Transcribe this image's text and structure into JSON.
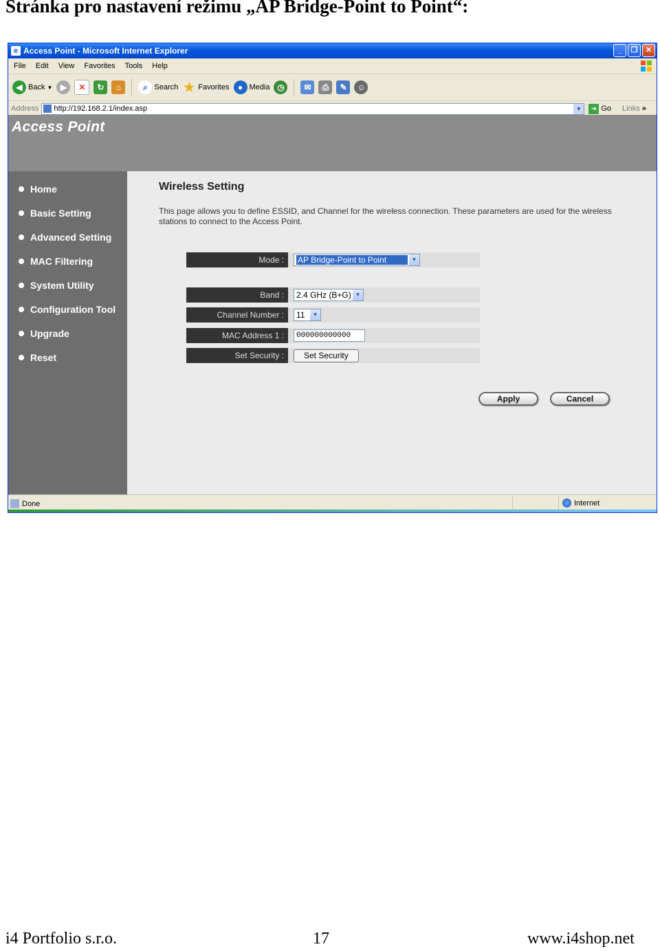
{
  "document": {
    "title": "Stránka pro nastavení režimu „AP Bridge-Point to Point“:"
  },
  "browser": {
    "window_title": "Access Point - Microsoft Internet Explorer",
    "menu": [
      "File",
      "Edit",
      "View",
      "Favorites",
      "Tools",
      "Help"
    ],
    "toolbar": {
      "back": "Back",
      "search": "Search",
      "favorites": "Favorites",
      "media": "Media"
    },
    "address_label": "Address",
    "url": "http://192.168.2.1/index.asp",
    "go": "Go",
    "links": "Links",
    "status_text": "Done",
    "status_zone": "Internet"
  },
  "page": {
    "banner_title": "Access Point",
    "nav": [
      {
        "label": "Home"
      },
      {
        "label": "Basic Setting"
      },
      {
        "label": "Advanced Setting"
      },
      {
        "label": "MAC Filtering"
      },
      {
        "label": "System Utility"
      },
      {
        "label": "Configuration Tool"
      },
      {
        "label": "Upgrade"
      },
      {
        "label": "Reset"
      }
    ],
    "heading": "Wireless Setting",
    "description": "This page allows you to define ESSID, and Channel for the wireless connection. These parameters are used for the wireless stations to connect to the Access Point.",
    "form": {
      "mode_label": "Mode :",
      "mode_value": "AP Bridge-Point to Point",
      "band_label": "Band :",
      "band_value": "2.4 GHz (B+G)",
      "channel_label": "Channel Number :",
      "channel_value": "11",
      "mac_label": "MAC Address 1 :",
      "mac_value": "000000000000",
      "security_label": "Set Security :",
      "security_button": "Set Security"
    },
    "apply": "Apply",
    "cancel": "Cancel"
  },
  "footer": {
    "company": "i4 Portfolio s.r.o.",
    "page_number": "17",
    "website": "www.i4shop.net"
  },
  "colors": {
    "titlebar": "#0a5ae0",
    "sidebar": "#6e6e6e",
    "banner": "#8c8c8c",
    "label_cell": "#333333",
    "selection": "#316ac5"
  }
}
